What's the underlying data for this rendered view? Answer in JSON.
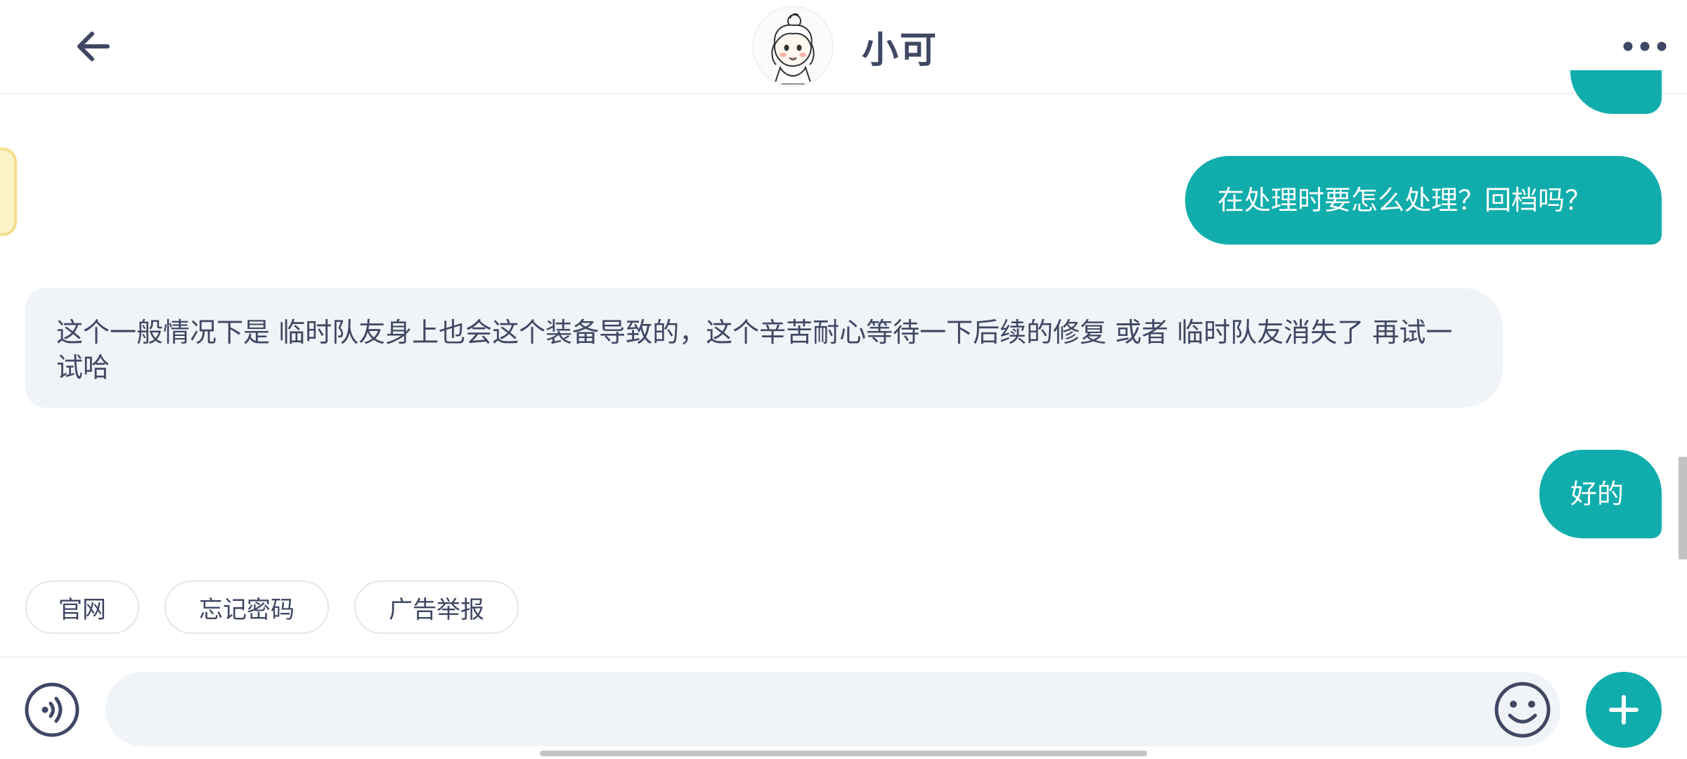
{
  "header": {
    "title": "小可",
    "back_icon": "arrow-left-icon",
    "more_icon": "more-horizontal-icon"
  },
  "messages": [
    {
      "role": "user",
      "text": "在处理时要怎么处理？回档吗？"
    },
    {
      "role": "bot",
      "text": "这个一般情况下是 临时队友身上也会这个装备导致的，这个辛苦耐心等待一下后续的修复 或者 临时队友消失了 再试一试哈"
    },
    {
      "role": "user",
      "text": "好的"
    }
  ],
  "quick_replies": [
    "官网",
    "忘记密码",
    "广告举报"
  ],
  "input": {
    "value": "",
    "placeholder": "",
    "voice_icon": "voice-icon",
    "emoji_icon": "emoji-icon",
    "plus_icon": "plus-icon"
  },
  "colors": {
    "accent": "#10adac",
    "bot_bubble": "#f0f3f7",
    "text": "#3f4763"
  }
}
